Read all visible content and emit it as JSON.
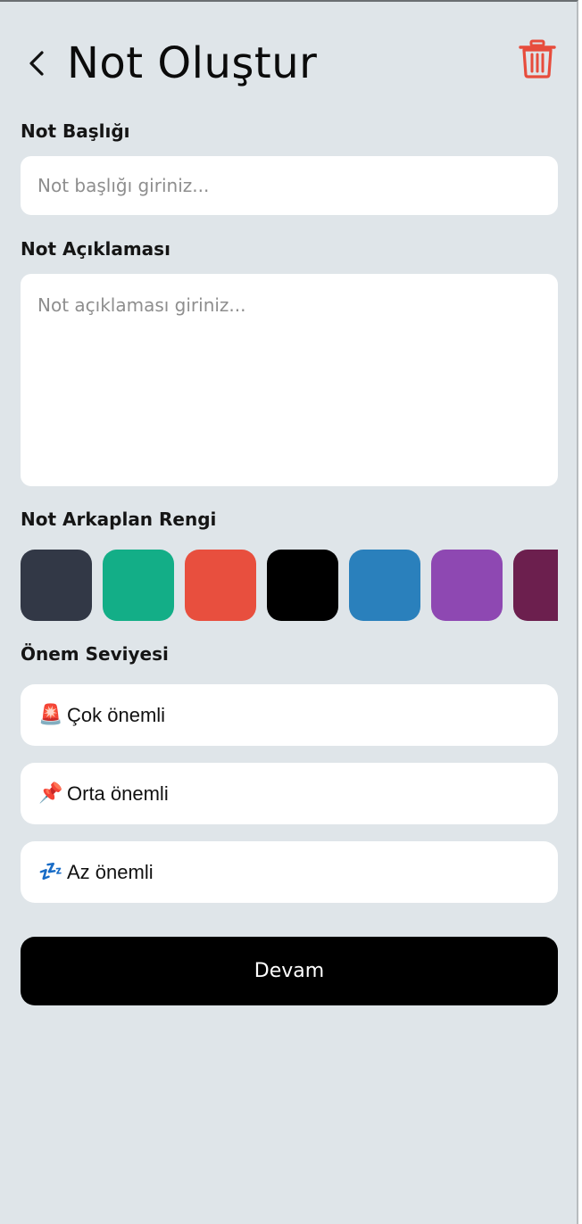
{
  "header": {
    "title": "Not Oluştur",
    "back_icon": "chevron-left-icon",
    "delete_icon": "trash-icon"
  },
  "title_field": {
    "label": "Not Başlığı",
    "placeholder": "Not başlığı giriniz...",
    "value": ""
  },
  "description_field": {
    "label": "Not Açıklaması",
    "placeholder": "Not açıklaması giriniz...",
    "value": ""
  },
  "colors": {
    "label": "Not Arkaplan Rengi",
    "swatches": [
      "#323846",
      "#13ae87",
      "#e84f3e",
      "#000000",
      "#2a80bc",
      "#8e48b2",
      "#6c1f4e"
    ]
  },
  "importance": {
    "label": "Önem Seviyesi",
    "options": [
      {
        "icon": "🚨",
        "label": "Çok önemli"
      },
      {
        "icon": "📌",
        "label": "Orta önemli"
      },
      {
        "icon": "💤",
        "label": "Az önemli"
      }
    ]
  },
  "actions": {
    "continue_label": "Devam"
  },
  "theme": {
    "background": "#dfe5e9",
    "accent_delete": "#e74c3c",
    "button": "#000000"
  }
}
